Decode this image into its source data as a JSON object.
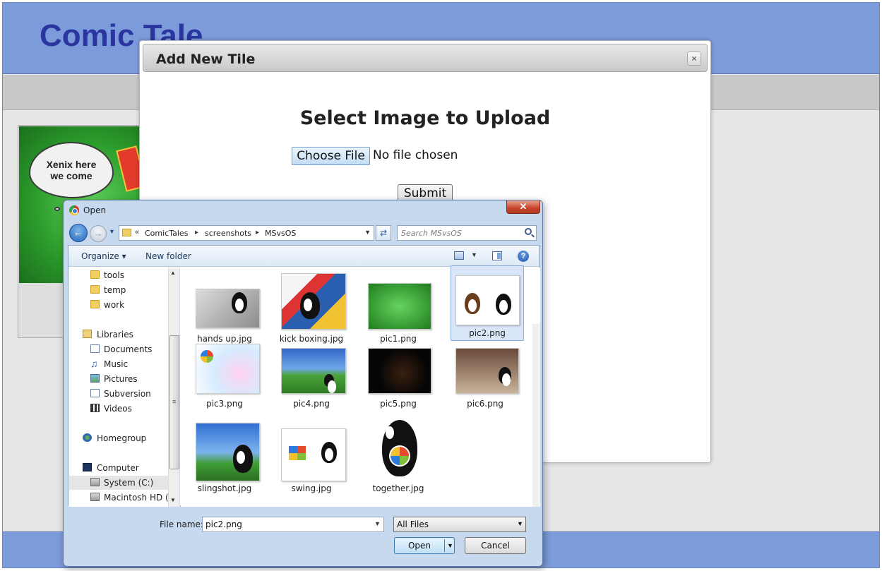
{
  "site": {
    "title": "Comic Tale",
    "tile_text_line1": "Xenix here",
    "tile_text_line2": "we come"
  },
  "modal": {
    "title": "Add New Tile",
    "close_label": "×",
    "heading": "Select Image to Upload",
    "choose_file_label": "Choose File",
    "file_status": "No file chosen",
    "submit_label": "Submit"
  },
  "open_dialog": {
    "title": "Open",
    "close_label": "✕",
    "breadcrumb": [
      "ComicTales",
      "screenshots",
      "MSvsOS"
    ],
    "breadcrumb_prefix": "«",
    "search_placeholder": "Search MSvsOS",
    "toolbar": {
      "organize_label": "Organize ▾",
      "new_folder_label": "New folder",
      "help_label": "?"
    },
    "nav_items": [
      {
        "label": "tools",
        "icon": "folder-icon"
      },
      {
        "label": "temp",
        "icon": "folder-icon"
      },
      {
        "label": "work",
        "icon": "folder-icon"
      },
      {
        "label": "Libraries",
        "icon": "libraries-icon"
      },
      {
        "label": "Documents",
        "icon": "documents-icon"
      },
      {
        "label": "Music",
        "icon": "music-icon"
      },
      {
        "label": "Pictures",
        "icon": "pictures-icon"
      },
      {
        "label": "Subversion",
        "icon": "subversion-icon"
      },
      {
        "label": "Videos",
        "icon": "videos-icon"
      },
      {
        "label": "Homegroup",
        "icon": "homegroup-icon"
      },
      {
        "label": "Computer",
        "icon": "computer-icon"
      },
      {
        "label": "System (C:)",
        "icon": "drive-icon"
      },
      {
        "label": "Macintosh HD (E",
        "icon": "drive-icon"
      }
    ],
    "files": [
      {
        "name": "hands up.jpg",
        "selected": false
      },
      {
        "name": "kick boxing.jpg",
        "selected": false
      },
      {
        "name": "pic1.png",
        "selected": false
      },
      {
        "name": "pic2.png",
        "selected": true
      },
      {
        "name": "pic3.png",
        "selected": false
      },
      {
        "name": "pic4.png",
        "selected": false
      },
      {
        "name": "pic5.png",
        "selected": false
      },
      {
        "name": "pic6.png",
        "selected": false
      },
      {
        "name": "slingshot.jpg",
        "selected": false
      },
      {
        "name": "swing.jpg",
        "selected": false
      },
      {
        "name": "together.jpg",
        "selected": false
      }
    ],
    "filename_label": "File name:",
    "filename_value": "pic2.png",
    "filetype_value": "All Files",
    "open_label": "Open",
    "cancel_label": "Cancel",
    "colors": {
      "selection": "#d8e6f7",
      "accent": "#3c7fb1"
    }
  }
}
